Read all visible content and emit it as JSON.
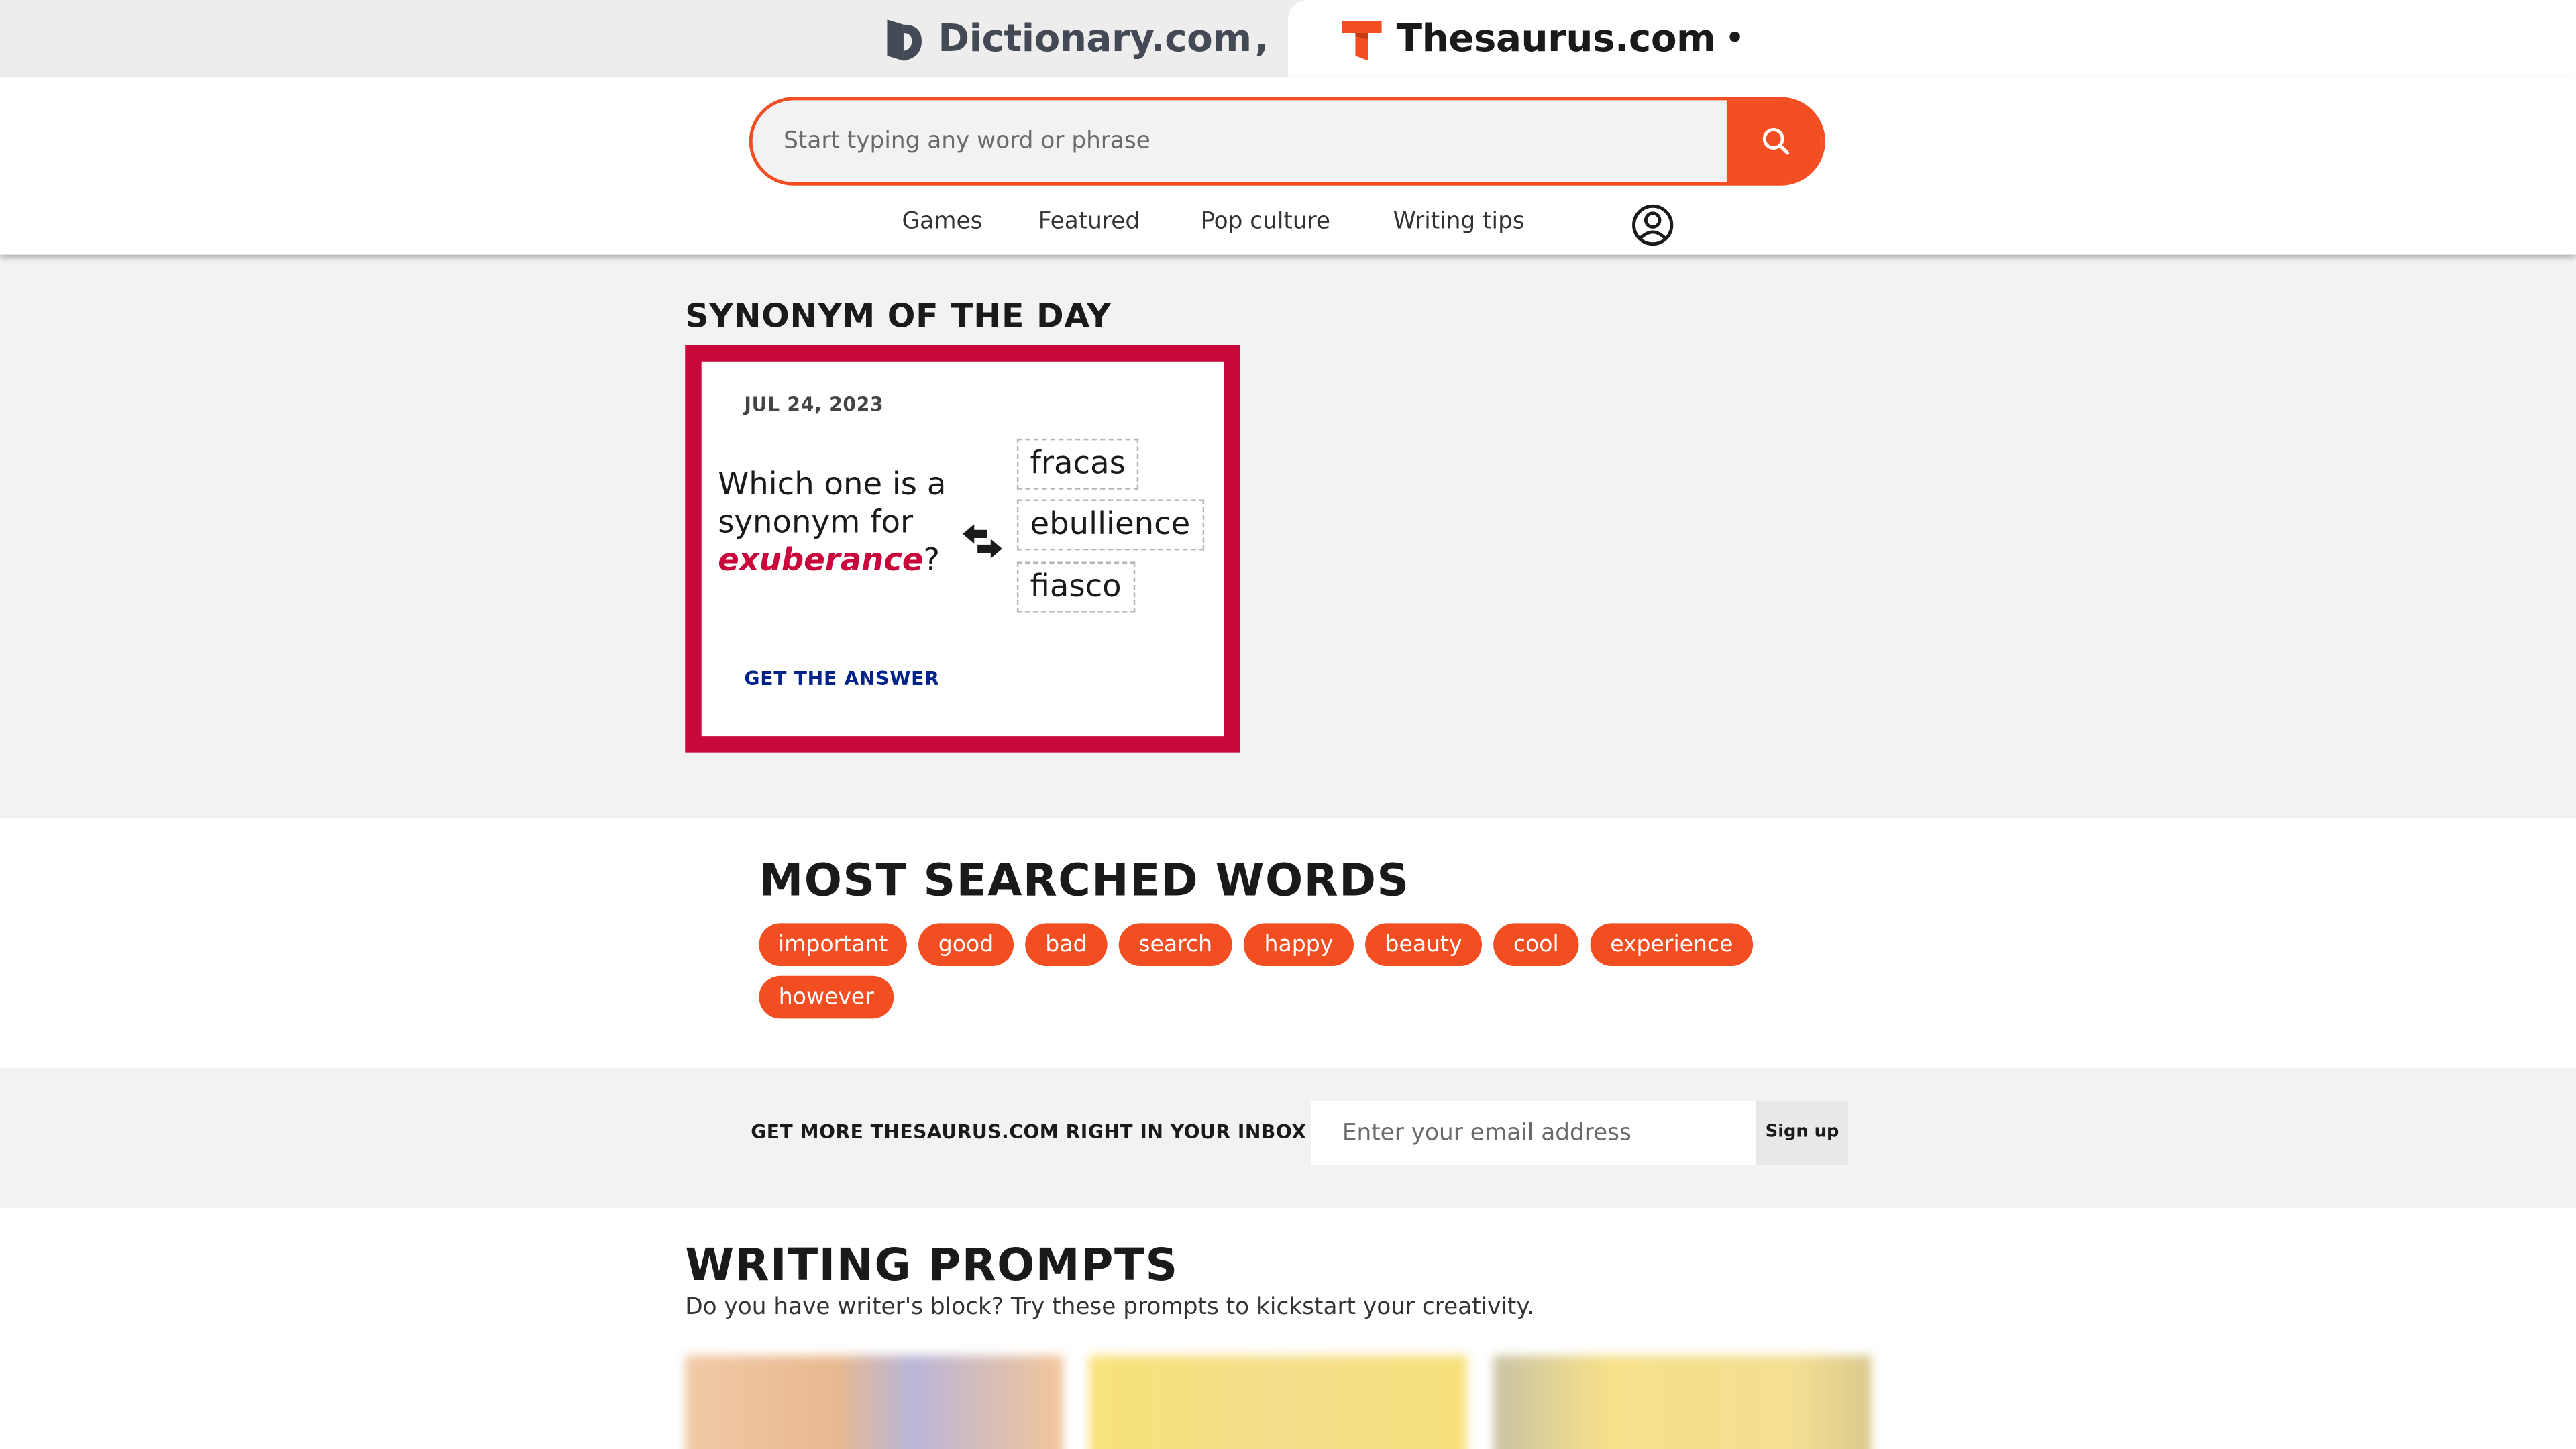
{
  "brands": {
    "dictionary": {
      "name": "Dictionary.com",
      "mark": ",",
      "color": "#444a55"
    },
    "thesaurus": {
      "name": "Thesaurus.com",
      "mark": "•",
      "color": "#f24e22"
    }
  },
  "search": {
    "placeholder": "Start typing any word or phrase",
    "value": ""
  },
  "nav": {
    "items": [
      "Games",
      "Featured",
      "Pop culture",
      "Writing tips"
    ]
  },
  "synonym_of_the_day": {
    "heading": "SYNONYM OF THE DAY",
    "date": "JUL 24, 2023",
    "question_prefix": "Which one is a synonym for",
    "word": "exuberance",
    "question_suffix": "?",
    "options": [
      "fracas",
      "ebullience",
      "fiasco"
    ],
    "cta": "GET THE ANSWER"
  },
  "most_searched": {
    "heading": "MOST SEARCHED WORDS",
    "words": [
      "important",
      "good",
      "bad",
      "search",
      "happy",
      "beauty",
      "cool",
      "experience",
      "however"
    ]
  },
  "newsletter": {
    "label": "GET MORE THESAURUS.COM RIGHT IN YOUR INBOX",
    "placeholder": "Enter your email address",
    "button": "Sign up"
  },
  "writing_prompts": {
    "heading": "WRITING PROMPTS",
    "subheading": "Do you have writer's block? Try these prompts to kickstart your creativity."
  },
  "colors": {
    "accent": "#f24e22",
    "sotd_red": "#c8083b",
    "link_blue": "#00248b",
    "bg_gray": "#f2f2f2"
  }
}
